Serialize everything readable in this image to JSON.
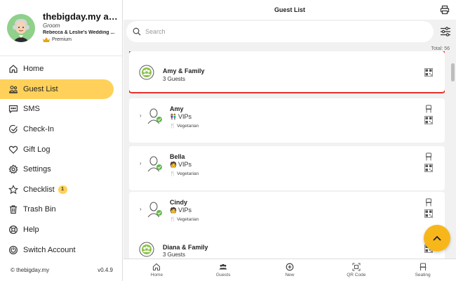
{
  "profile": {
    "name": "thebigday.my ad...",
    "role": "Groom",
    "event": "Rebecca & Leslie's Wedding ...",
    "plan": "Premium"
  },
  "nav": {
    "items": [
      {
        "label": "Home"
      },
      {
        "label": "Guest List"
      },
      {
        "label": "SMS"
      },
      {
        "label": "Check-In"
      },
      {
        "label": "Gift Log"
      },
      {
        "label": "Settings"
      },
      {
        "label": "Checklist",
        "badge": "1"
      },
      {
        "label": "Trash Bin"
      },
      {
        "label": "Help"
      },
      {
        "label": "Switch Account"
      }
    ],
    "active": "Guest List"
  },
  "footer": {
    "copyright": "© thebigday.my",
    "version": "v0.4.9"
  },
  "header": {
    "title": "Guest List"
  },
  "search": {
    "placeholder": "Search",
    "value": ""
  },
  "list": {
    "total": "Total: 56",
    "groups": [
      {
        "name": "Amy & Family",
        "count": "3 Guests"
      },
      {
        "name": "Diana & Family",
        "count": "3 Guests"
      }
    ],
    "guests": [
      {
        "name": "Amy",
        "category": "VIPs",
        "diet": "Vegetarian"
      },
      {
        "name": "Bella",
        "category": "VIPs",
        "diet": "Vegetarian"
      },
      {
        "name": "Cindy",
        "category": "VIPs",
        "diet": "Vegetarian"
      }
    ]
  },
  "tabbar": {
    "tabs": [
      {
        "label": "Home"
      },
      {
        "label": "Guests"
      },
      {
        "label": "New"
      },
      {
        "label": "QR Code"
      },
      {
        "label": "Seating"
      }
    ]
  },
  "colors": {
    "accent": "#ffd15a",
    "fab": "#f7b71b",
    "highlight": "#e8302a",
    "check_green": "#62b94a"
  }
}
